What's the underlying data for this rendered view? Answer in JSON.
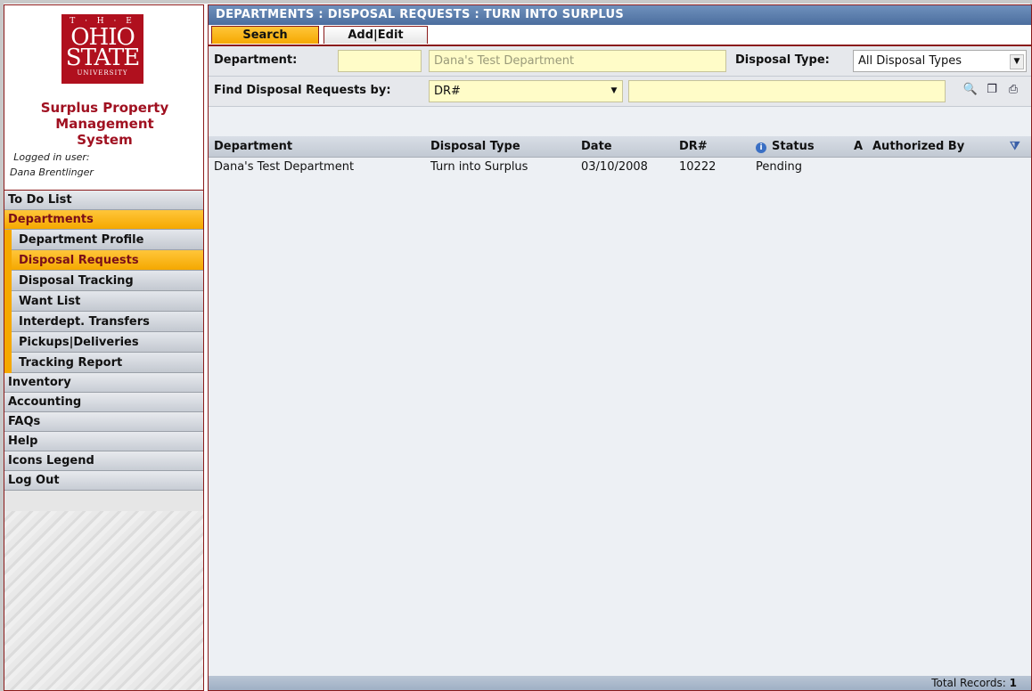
{
  "logo": {
    "the": "T · H · E",
    "line1": "OHIO",
    "line2": "STATE",
    "line3": "UNIVERSITY"
  },
  "app": {
    "title_line1": "Surplus Property",
    "title_line2": "Management",
    "title_line3": "System"
  },
  "user": {
    "label": "Logged in user:",
    "name": "Dana Brentlinger"
  },
  "nav": {
    "todo": "To Do List",
    "departments": "Departments",
    "sub": [
      "Department Profile",
      "Disposal Requests",
      "Disposal Tracking",
      "Want List",
      "Interdept. Transfers",
      "Pickups|Deliveries",
      "Tracking Report"
    ],
    "inventory": "Inventory",
    "accounting": "Accounting",
    "faqs": "FAQs",
    "help": "Help",
    "icons_legend": "Icons Legend",
    "logout": "Log Out"
  },
  "header": {
    "title": "DEPARTMENTS : DISPOSAL REQUESTS : TURN INTO SURPLUS"
  },
  "tabs": {
    "search": "Search",
    "add_edit": "Add|Edit"
  },
  "filters": {
    "department_label": "Department:",
    "department_code": "",
    "department_name": "Dana's Test Department",
    "disposal_type_label": "Disposal Type:",
    "disposal_type_value": "All Disposal Types",
    "find_label": "Find Disposal Requests by:",
    "find_by_value": "DR#",
    "find_text": ""
  },
  "table": {
    "headers": {
      "department": "Department",
      "disposal_type": "Disposal Type",
      "date": "Date",
      "dr": "DR#",
      "status": "Status",
      "a": "A",
      "authorized_by": "Authorized By"
    },
    "rows": [
      {
        "department": "Dana's Test Department",
        "disposal_type": "Turn into Surplus",
        "date": "03/10/2008",
        "dr": "10222",
        "status": "Pending",
        "a": "",
        "authorized_by": ""
      }
    ]
  },
  "footer": {
    "total_label": "Total Records:",
    "total_value": "1"
  },
  "colors": {
    "accent": "#f5a800",
    "brand": "#b0101e",
    "titlebar": "#4c6e9e"
  }
}
